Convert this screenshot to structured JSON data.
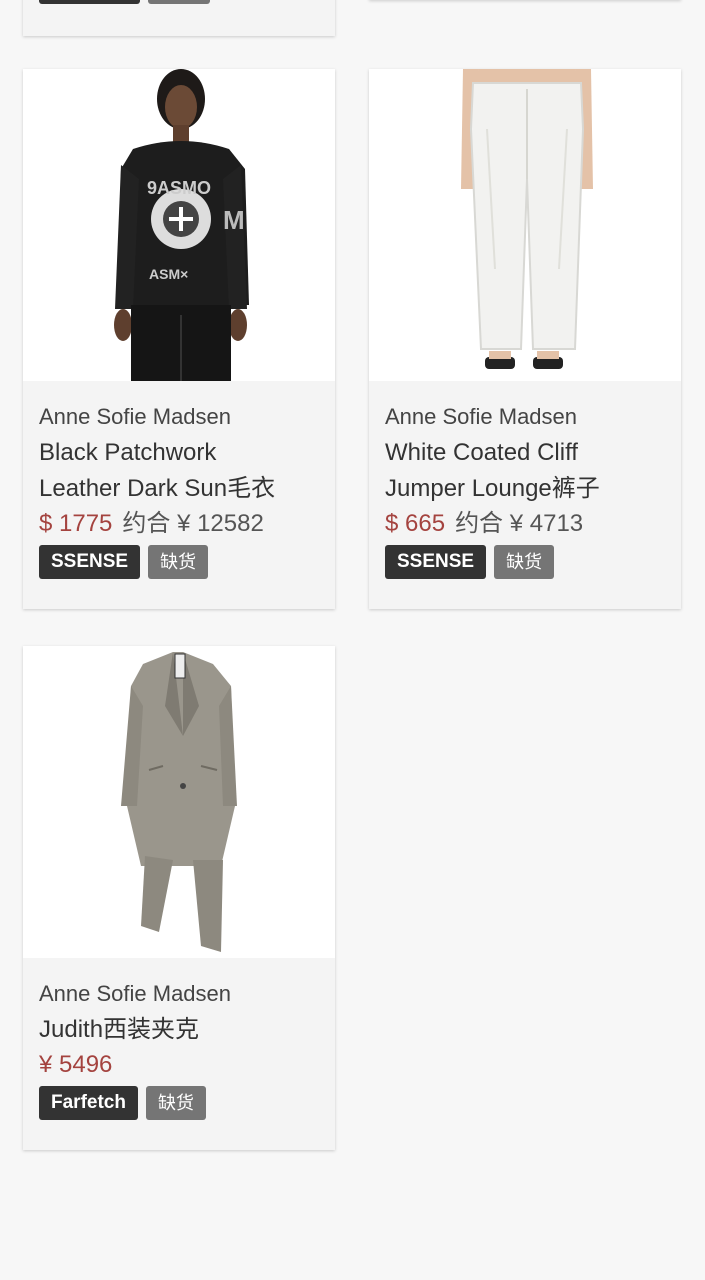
{
  "products": [
    {
      "brand": "Anne Sofie Madsen",
      "name_line1": "Black Patchwork",
      "name_line2": "Leather Dark Sun毛衣",
      "price": "$ 1775",
      "approx_price": "约合 ¥ 12582",
      "store": "SSENSE",
      "stock": "缺货",
      "image_icon": "black-sweater-image"
    },
    {
      "brand": "Anne Sofie Madsen",
      "name_line1": "White Coated Cliff",
      "name_line2": "Jumper Lounge裤子",
      "price": "$ 665",
      "approx_price": "约合 ¥ 4713",
      "store": "SSENSE",
      "stock": "缺货",
      "image_icon": "white-pants-image"
    },
    {
      "brand": "Anne Sofie Madsen",
      "name_line1": "Judith西装夹克",
      "name_line2": "",
      "price": "¥ 5496",
      "approx_price": "",
      "store": "Farfetch",
      "stock": "缺货",
      "image_icon": "grey-coat-image"
    }
  ]
}
